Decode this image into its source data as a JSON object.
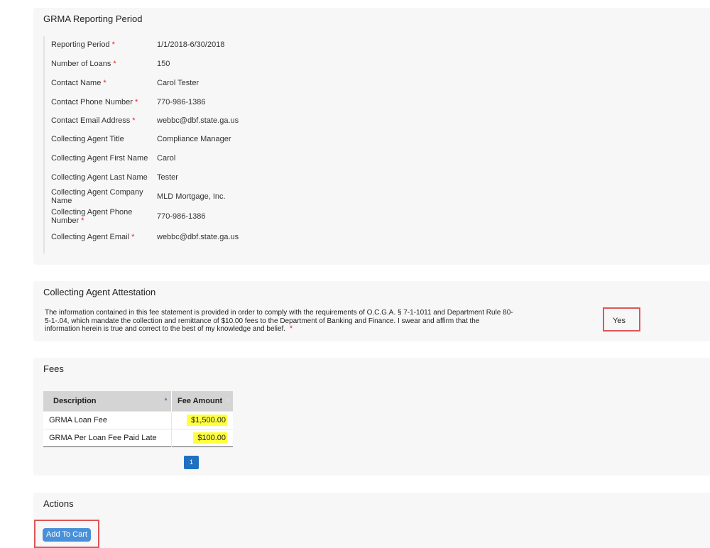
{
  "reporting_period": {
    "title": "GRMA Reporting Period",
    "required_marker": "*",
    "fields": [
      {
        "label": "Reporting Period",
        "value": "1/1/2018-6/30/2018",
        "required": true
      },
      {
        "label": "Number of Loans",
        "value": "150",
        "required": true
      },
      {
        "label": "Contact Name",
        "value": "Carol Tester",
        "required": true
      },
      {
        "label": "Contact Phone Number",
        "value": "770-986-1386",
        "required": true
      },
      {
        "label": "Contact Email Address",
        "value": "webbc@dbf.state.ga.us",
        "required": true
      },
      {
        "label": "Collecting Agent Title",
        "value": "Compliance Manager",
        "required": false
      },
      {
        "label": "Collecting Agent First Name",
        "value": "Carol",
        "required": false
      },
      {
        "label": "Collecting Agent Last Name",
        "value": "Tester",
        "required": false
      },
      {
        "label": "Collecting Agent Company Name",
        "value": "MLD Mortgage, Inc.",
        "required": false
      },
      {
        "label": "Collecting Agent Phone Number",
        "value": "770-986-1386",
        "required": true
      },
      {
        "label": "Collecting Agent Email",
        "value": "webbc@dbf.state.ga.us",
        "required": true
      }
    ]
  },
  "attestation": {
    "title": "Collecting Agent Attestation",
    "text": "The information contained in this fee statement is provided in order to comply with the requirements of O.C.G.A. § 7-1-1011 and Department Rule 80-5-1-.04, which mandate the collection and remittance of $10.00 fees to the Department of Banking and Finance. I swear and affirm that the information herein is true and correct to the best of my knowledge and belief.",
    "required": true,
    "answer": "Yes"
  },
  "fees": {
    "title": "Fees",
    "columns": [
      "Description",
      "Fee Amount"
    ],
    "rows": [
      {
        "description": "GRMA Loan Fee",
        "amount": "$1,500.00"
      },
      {
        "description": "GRMA Per Loan Fee Paid Late",
        "amount": "$100.00"
      }
    ],
    "sort_icons": {
      "description": "▲",
      "amount": "⇕"
    },
    "pagination": {
      "current_page": "1"
    }
  },
  "actions": {
    "title": "Actions",
    "add_to_cart_label": "Add To Cart"
  },
  "colors": {
    "panel_bg": "#f7f7f7",
    "required": "#e8202a",
    "highlight_box": "#e05555",
    "highlight_text": "#ffff40",
    "button_primary": "#4a90d9",
    "pagination_active": "#1f70c1"
  }
}
